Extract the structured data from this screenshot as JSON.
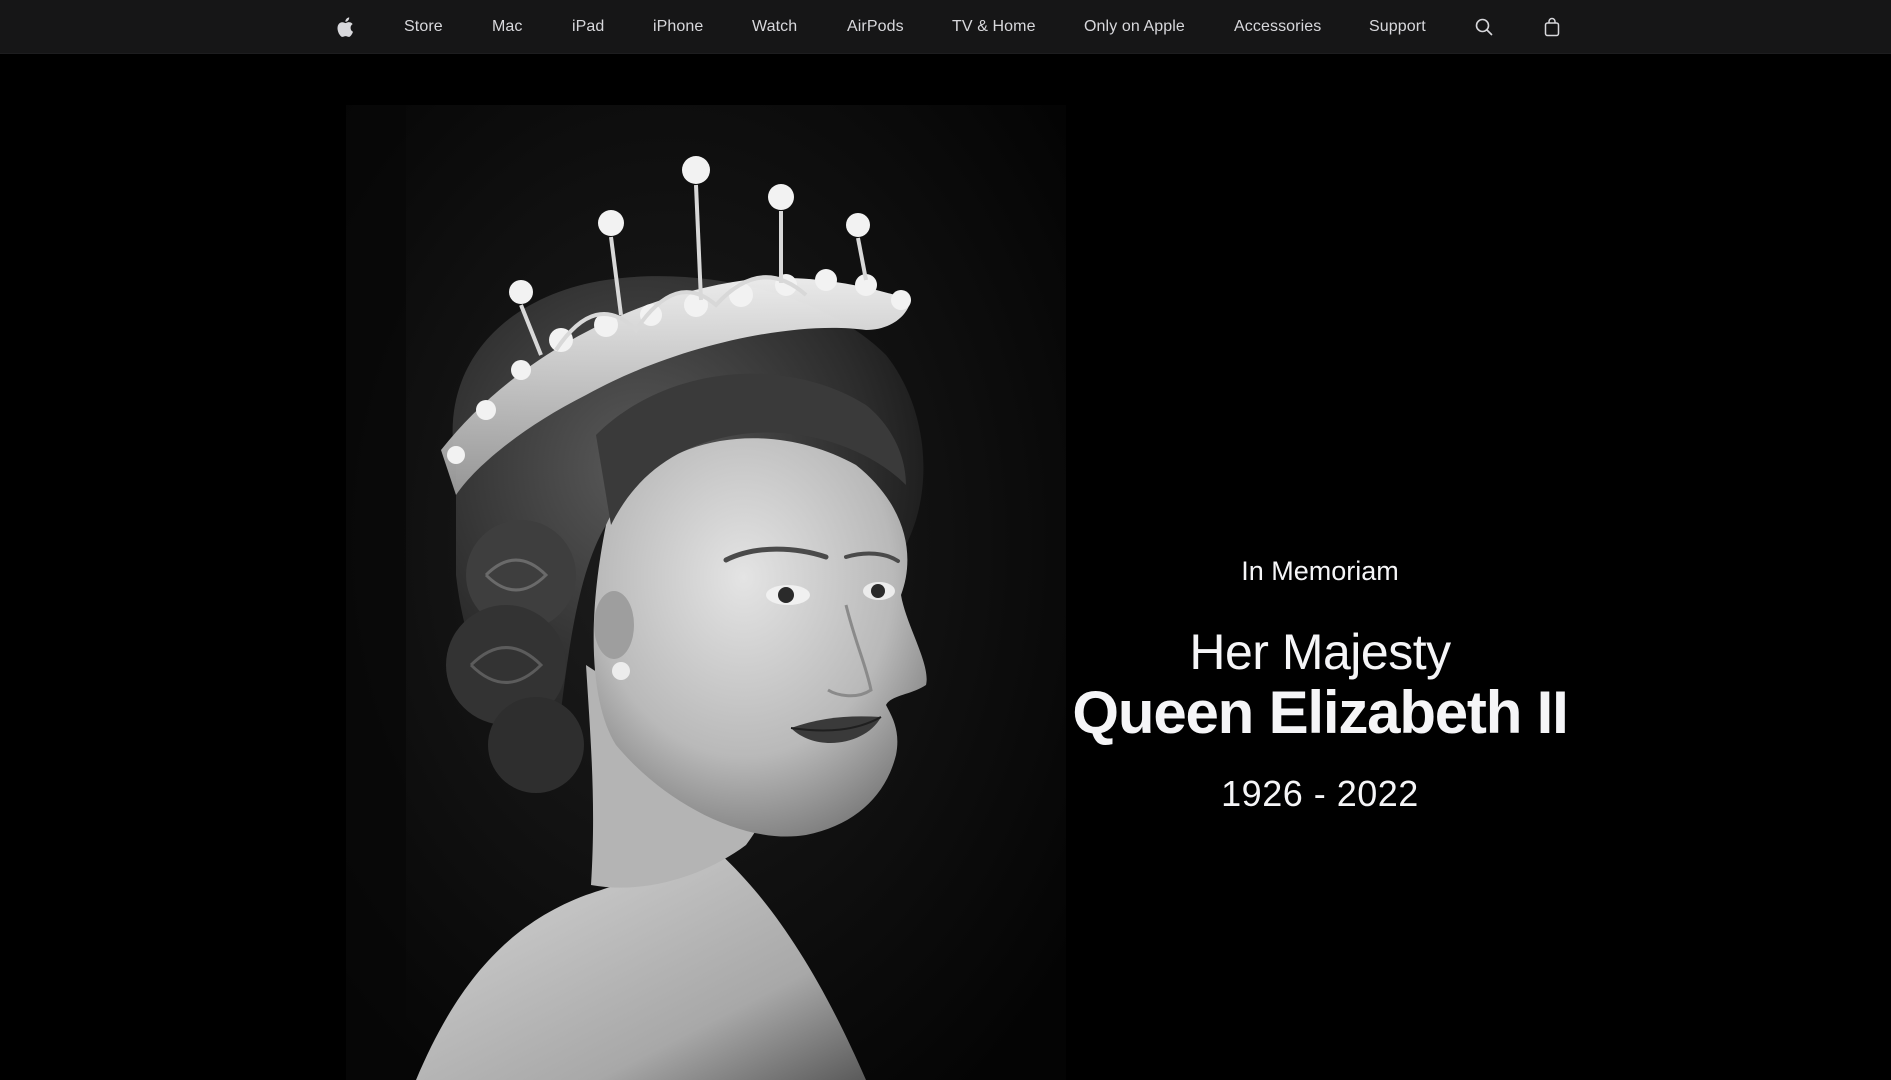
{
  "nav": {
    "logo_icon": "apple-logo-icon",
    "items": [
      "Store",
      "Mac",
      "iPad",
      "iPhone",
      "Watch",
      "AirPods",
      "TV & Home",
      "Only on Apple",
      "Accessories",
      "Support"
    ],
    "search_icon": "search-icon",
    "bag_icon": "shopping-bag-icon",
    "background": "#161617",
    "text_color": "#d8d8dc"
  },
  "hero": {
    "kicker": "In Memoriam",
    "honorific": "Her Majesty",
    "name": "Queen Elizabeth II",
    "years": "1926 - 2022",
    "background": "#000000",
    "text_color": "#f5f5f7",
    "image": "black-and-white-portrait-of-queen-elizabeth-ii-wearing-tiara"
  }
}
